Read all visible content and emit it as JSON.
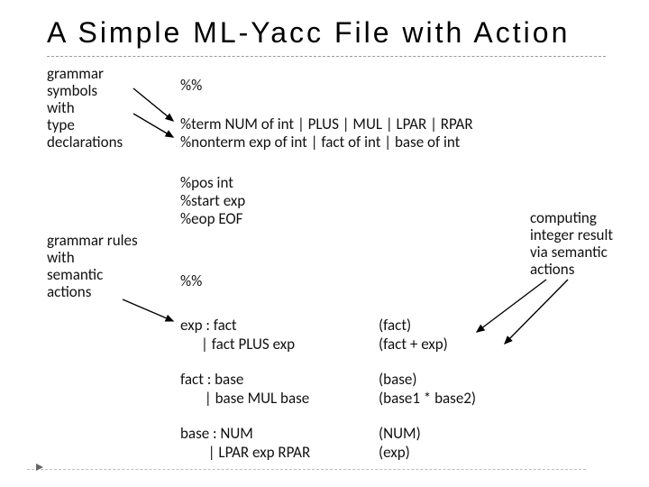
{
  "title": "A Simple ML-Yacc File with Action",
  "labels": {
    "left1_l1": "grammar",
    "left1_l2": "symbols",
    "left1_l3": "with",
    "left1_l4": "type",
    "left1_l5": "declarations",
    "left2_l1": "grammar rules",
    "left2_l2": "with",
    "left2_l3": "semantic",
    "left2_l4": "actions",
    "right_l1": "computing",
    "right_l2": "integer result",
    "right_l3": "via semantic",
    "right_l4": "actions"
  },
  "code": {
    "sep1": "%%",
    "term": "%term NUM of int | PLUS | MUL | LPAR | RPAR",
    "nonterm": "%nonterm exp of int | fact of int | base of int",
    "pos": "%pos int",
    "start": "%start exp",
    "eop": "%eop EOF",
    "sep2": "%%",
    "r1a": "exp : fact",
    "r1b": "      | fact PLUS exp",
    "r1va": "(fact)",
    "r1vb": "(fact + exp)",
    "r2a": "fact : base",
    "r2b": "       | base MUL base",
    "r2va": "(base)",
    "r2vb": "(base1 * base2)",
    "r3a": "base : NUM",
    "r3b": "        | LPAR exp RPAR",
    "r3va": "(NUM)",
    "r3vb": "(exp)"
  }
}
